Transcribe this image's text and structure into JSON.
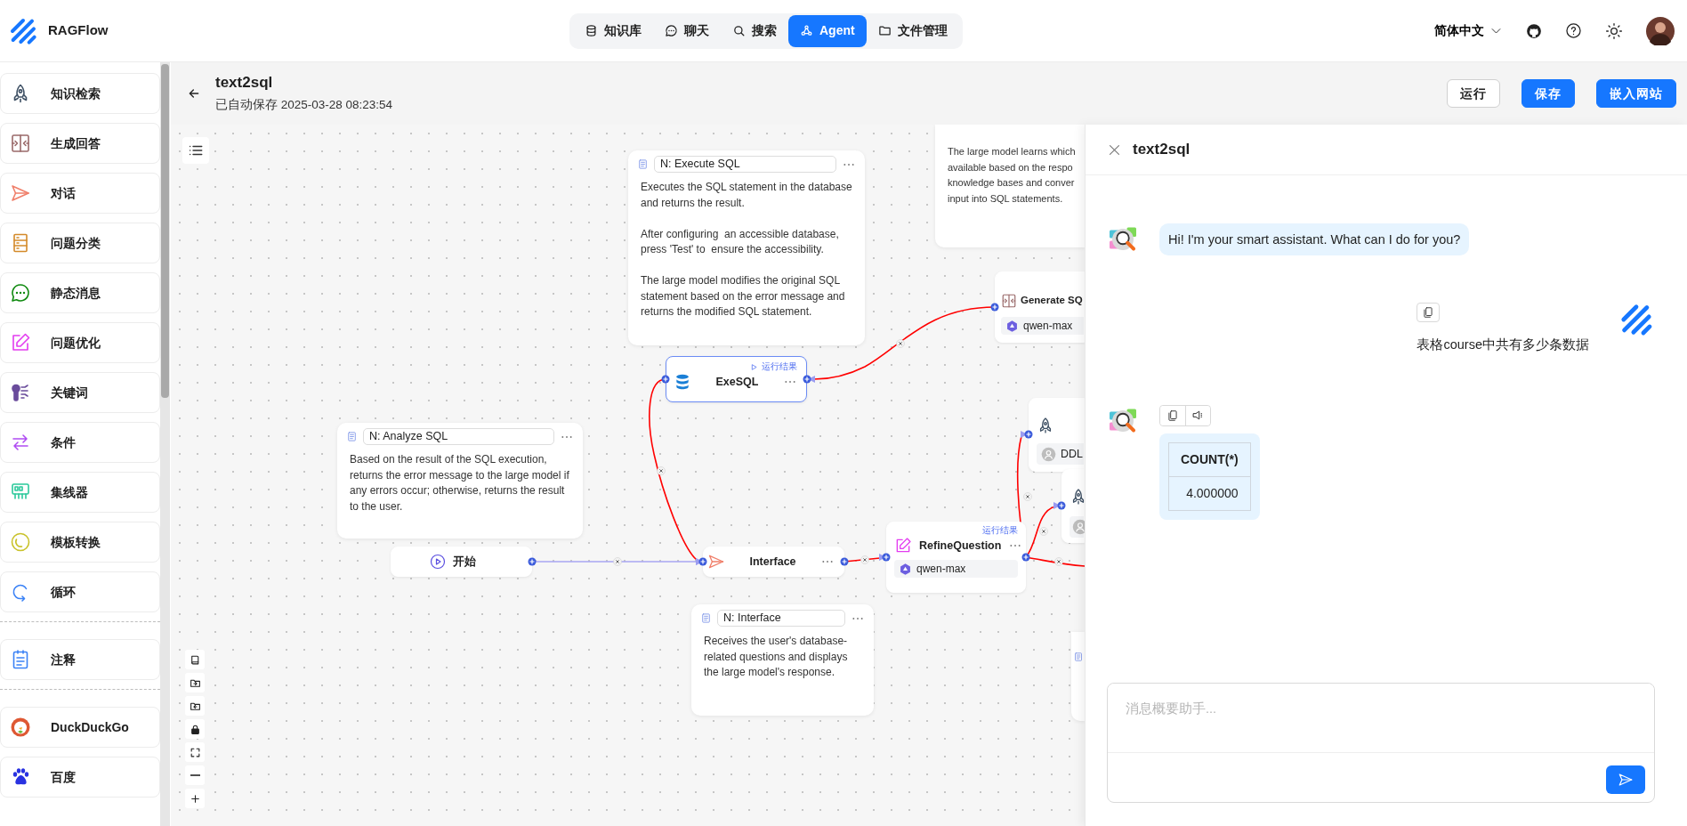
{
  "app": {
    "name": "RAGFlow"
  },
  "nav": [
    {
      "label": "知识库",
      "selected": false
    },
    {
      "label": "聊天",
      "selected": false
    },
    {
      "label": "搜索",
      "selected": false
    },
    {
      "label": "Agent",
      "selected": true
    },
    {
      "label": "文件管理",
      "selected": false
    }
  ],
  "language": "简体中文",
  "flow": {
    "title": "text2sql",
    "autosave": "已自动保存 2025-03-28 08:23:54"
  },
  "actions": [
    {
      "label": "运行",
      "kind": "outline"
    },
    {
      "label": "保存",
      "kind": "primary"
    },
    {
      "label": "嵌入网站",
      "kind": "primary"
    }
  ],
  "sidebar": {
    "groups": [
      {
        "items": [
          {
            "label": "知识检索"
          },
          {
            "label": "生成回答"
          },
          {
            "label": "对话"
          },
          {
            "label": "问题分类"
          },
          {
            "label": "静态消息"
          },
          {
            "label": "问题优化"
          },
          {
            "label": "关键词"
          },
          {
            "label": "条件"
          },
          {
            "label": "集线器"
          },
          {
            "label": "模板转换"
          },
          {
            "label": "循环"
          }
        ]
      },
      {
        "items": [
          {
            "label": "注释"
          }
        ]
      },
      {
        "items": [
          {
            "label": "DuckDuckGo"
          },
          {
            "label": "百度"
          }
        ]
      }
    ]
  },
  "canvas": {
    "notes": [
      {
        "kind": "note",
        "title": "N: Execute SQL",
        "text": "Executes the SQL statement in the database and returns the result.\n\nAfter configuring  an accessible database, press 'Test' to  ensure the accessibility.\n\nThe large model modifies the original SQL statement based on the error message and returns the modified SQL statement."
      },
      {
        "kind": "note",
        "title": "N: Analyze SQL",
        "text": "Based on the result of the SQL execution, returns the error message to the large model if any errors occur; otherwise, returns the result to the user."
      },
      {
        "kind": "note",
        "title": "N: Interface",
        "text": "Receives the user's database-related questions and displays the large model's response."
      },
      {
        "kind": "clipped",
        "text": "The large model learns which\navailable based on the respo\nknowledge bases and conver\ninput into SQL statements."
      },
      {
        "kind": "clipped"
      }
    ],
    "nodes": [
      {
        "kind": "begin",
        "label": "开始",
        "selected": false
      },
      {
        "kind": "message",
        "label": "Interface",
        "selected": false
      },
      {
        "kind": "sql",
        "label": "ExeSQL",
        "selected": true,
        "status": "运行结果",
        "status_icon": true
      },
      {
        "kind": "rewrite",
        "label": "RefineQuestion",
        "selected": false,
        "status": "运行结果",
        "status_icon": false,
        "model": "qwen-max"
      },
      {
        "kind": "generate",
        "label": "Generate SQ",
        "selected": false,
        "model": "qwen-max"
      },
      {
        "kind": "retrieval",
        "selected": false,
        "tag": "DDL"
      },
      {
        "kind": "retrieval",
        "selected": false
      }
    ]
  },
  "chat": {
    "title": "text2sql",
    "messages": [
      {
        "kind": "assistant",
        "text": "Hi! I'm your smart assistant. What can I do for you?",
        "show_actions": false
      },
      {
        "kind": "user",
        "text": "表格course中共有多少条数据"
      },
      {
        "kind": "assistant",
        "show_actions": true,
        "table": {
          "columns": [
            "COUNT(*)"
          ],
          "rows": [
            [
              "4.000000"
            ]
          ]
        }
      }
    ],
    "input": {
      "placeholder": "消息概要助手..."
    }
  }
}
